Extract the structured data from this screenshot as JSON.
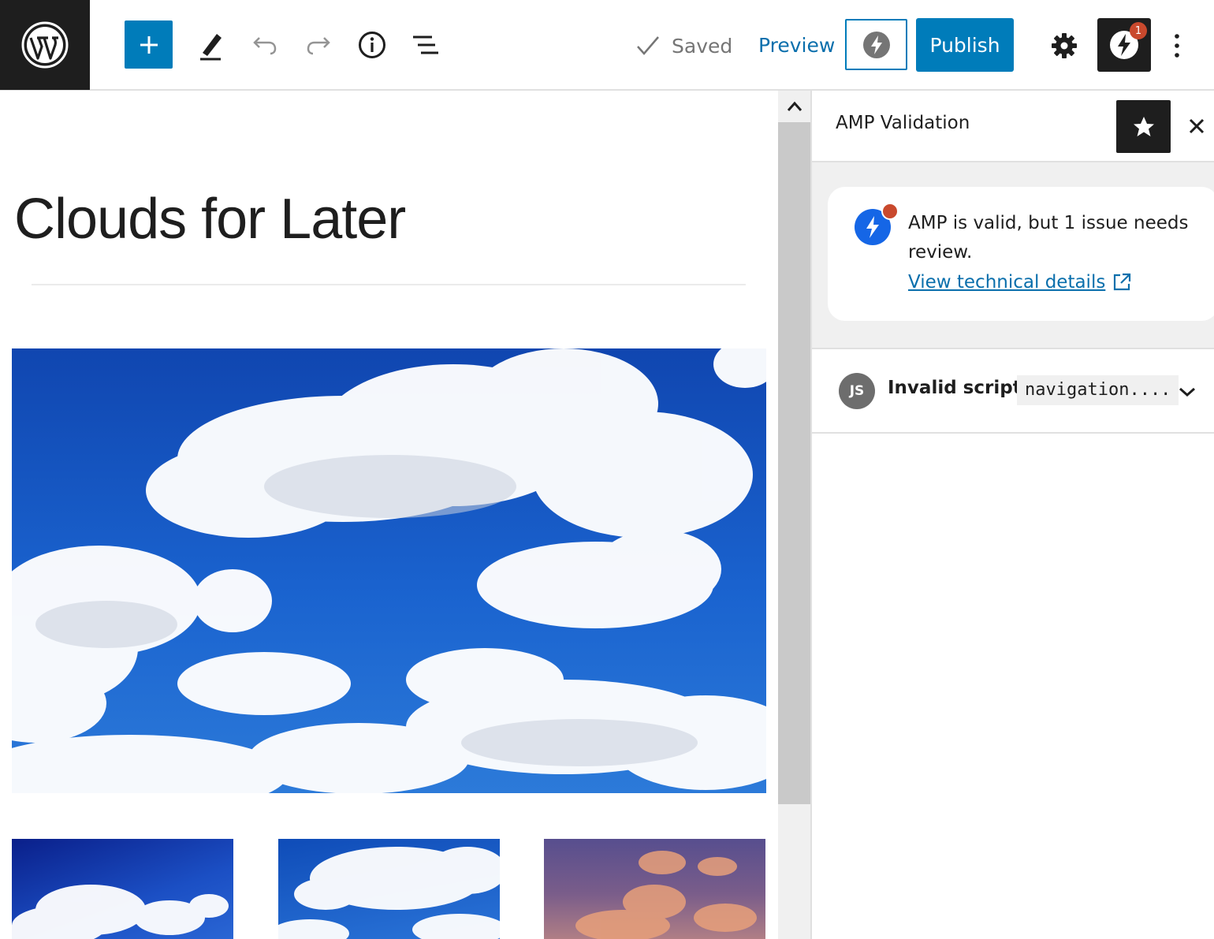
{
  "toolbar": {
    "logo": "wordpress-icon",
    "add_block": "plus-icon",
    "tools": "pencil-icon",
    "undo": "undo-icon",
    "redo": "redo-icon",
    "details": "info-icon",
    "outline": "list-view-icon",
    "saved_label": "Saved",
    "preview_label": "Preview",
    "publish_label": "Publish",
    "settings": "gear-icon",
    "amp_badge_count": "1",
    "more": "more-vertical-icon"
  },
  "editor": {
    "post_title": "Clouds for Later",
    "images": [
      "hero-clouds-image",
      "thumb-clouds-blue",
      "thumb-clouds-sky",
      "thumb-clouds-sunset"
    ]
  },
  "sidebar": {
    "title": "AMP Validation",
    "status": {
      "message": "AMP is valid, but 1 issue needs review.",
      "link_label": "View technical details"
    },
    "issues": [
      {
        "badge": "JS",
        "label": "Invalid script:",
        "code": "navigation...."
      }
    ]
  },
  "colors": {
    "accent": "#007cba",
    "link": "#0a6fac",
    "dark": "#1e1e1e",
    "warning_dot": "#c9492d",
    "amp_blue": "#1566e6"
  }
}
